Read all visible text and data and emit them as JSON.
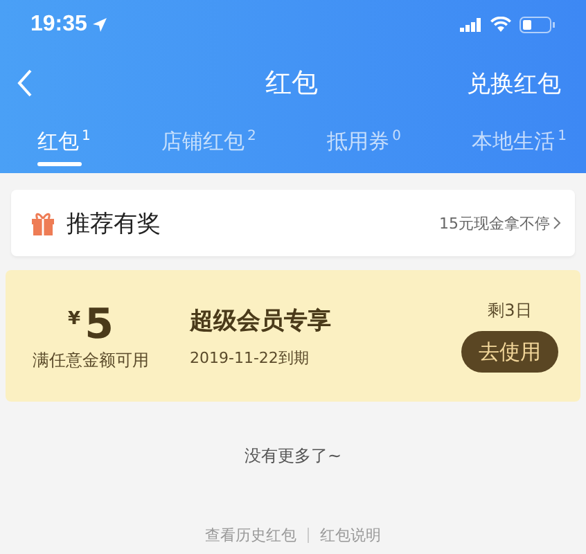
{
  "status_bar": {
    "time": "19:35"
  },
  "nav": {
    "title": "红包",
    "action": "兑换红包"
  },
  "tabs": [
    {
      "label": "红包",
      "count": "1",
      "selected": true
    },
    {
      "label": "店铺红包",
      "count": "2",
      "selected": false
    },
    {
      "label": "抵用券",
      "count": "0",
      "selected": false
    },
    {
      "label": "本地生活",
      "count": "1",
      "selected": false
    }
  ],
  "promo": {
    "title": "推荐有奖",
    "note": "15元现金拿不停"
  },
  "coupons": [
    {
      "currency": "¥",
      "amount": "5",
      "condition": "满任意金额可用",
      "title": "超级会员专享",
      "expiry": "2019-11-22到期",
      "remaining": "剩3日",
      "button": "去使用"
    }
  ],
  "end_note": "没有更多了~",
  "footer_links": [
    "查看历史红包",
    "红包说明"
  ]
}
